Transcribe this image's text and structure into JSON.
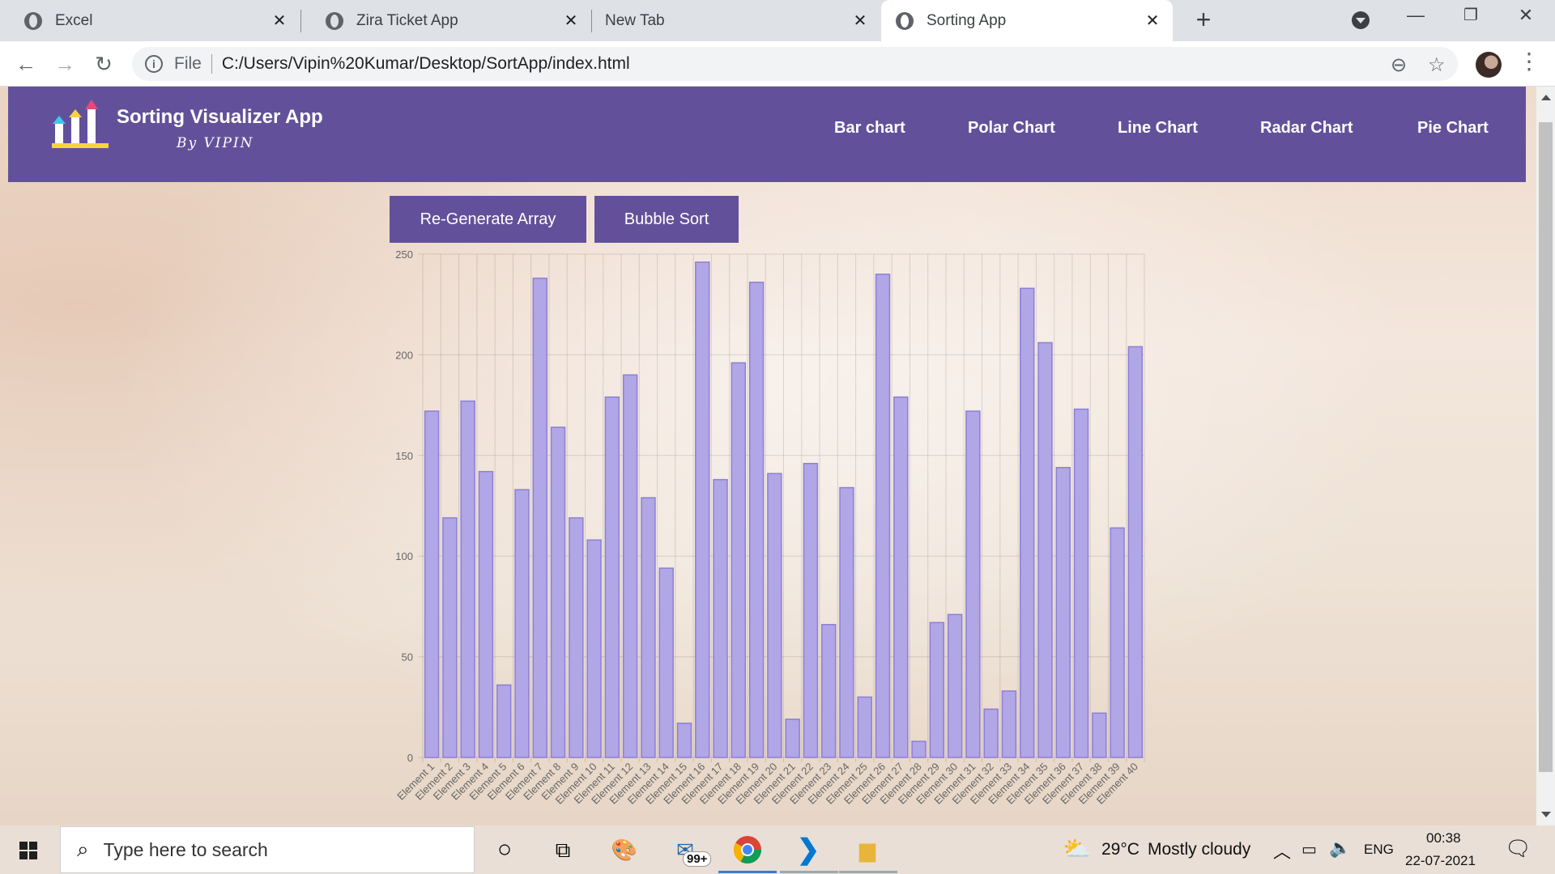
{
  "browser": {
    "tabs": [
      {
        "title": "Excel",
        "active": false
      },
      {
        "title": "Zira Ticket App",
        "active": false
      },
      {
        "title": "New Tab",
        "active": false
      },
      {
        "title": "Sorting App",
        "active": true
      }
    ],
    "address": {
      "scheme_label": "File",
      "url": "C:/Users/Vipin%20Kumar/Desktop/SortApp/index.html"
    }
  },
  "app": {
    "title": "Sorting Visualizer App",
    "subtitle": "By VIPIN",
    "nav": [
      "Bar chart",
      "Polar Chart",
      "Line Chart",
      "Radar Chart",
      "Pie Chart"
    ],
    "buttons": {
      "regenerate": "Re-Generate Array",
      "sort": "Bubble Sort"
    },
    "accent": "#62519a"
  },
  "chart_data": {
    "type": "bar",
    "categories": [
      "Element 1",
      "Element 2",
      "Element 3",
      "Element 4",
      "Element 5",
      "Element 6",
      "Element 7",
      "Element 8",
      "Element 9",
      "Element 10",
      "Element 11",
      "Element 12",
      "Element 13",
      "Element 14",
      "Element 15",
      "Element 16",
      "Element 17",
      "Element 18",
      "Element 19",
      "Element 20",
      "Element 21",
      "Element 22",
      "Element 23",
      "Element 24",
      "Element 25",
      "Element 26",
      "Element 27",
      "Element 28",
      "Element 29",
      "Element 30",
      "Element 31",
      "Element 32",
      "Element 33",
      "Element 34",
      "Element 35",
      "Element 36",
      "Element 37",
      "Element 38",
      "Element 39",
      "Element 40"
    ],
    "values": [
      172,
      119,
      177,
      142,
      36,
      133,
      238,
      164,
      119,
      108,
      179,
      190,
      129,
      94,
      17,
      246,
      138,
      196,
      236,
      141,
      19,
      146,
      66,
      134,
      30,
      240,
      179,
      8,
      67,
      71,
      172,
      24,
      33,
      233,
      206,
      144,
      173,
      22,
      114,
      204
    ],
    "ylim": [
      0,
      250
    ],
    "yticks": [
      0,
      50,
      100,
      150,
      200,
      250
    ],
    "grid": true,
    "bar_fill": "#b1a6e6",
    "bar_stroke": "#8d7fd6"
  },
  "taskbar": {
    "search_placeholder": "Type here to search",
    "mail_badge": "99+",
    "weather": {
      "temp": "29°C",
      "desc": "Mostly cloudy"
    },
    "language": "ENG",
    "time": "00:38",
    "date": "22-07-2021"
  }
}
